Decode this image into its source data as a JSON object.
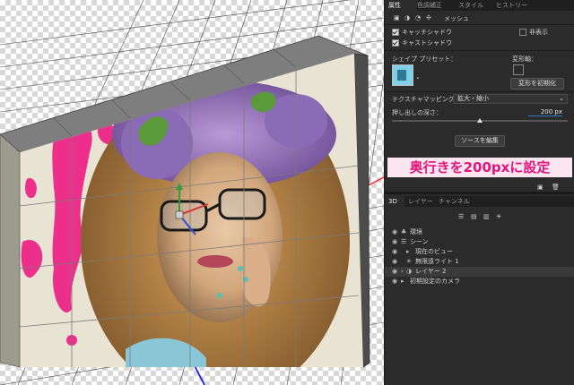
{
  "properties_panel": {
    "tabs": [
      "属性",
      "色調補正",
      "スタイル",
      "ヒストリー"
    ],
    "active_tab": "属性",
    "mode_label": "メッシュ",
    "catch_shadow": "キャッチシャドウ",
    "cast_shadow": "キャストシャドウ",
    "hide_label": "非表示",
    "shape_preset_label": "シェイプ プリセット：",
    "deform_axis_label": "変形軸：",
    "reset_deform_button": "変形を初期化",
    "texture_mapping_label": "テクスチャマッピング：",
    "texture_mapping_value": "拡大・縮小",
    "extrusion_depth_label": "押し出しの深さ：",
    "extrusion_depth_value": "200 px",
    "extrusion_depth_fraction": 0.5,
    "edit_source_button": "ソースを編集",
    "callout": "奥行きを200pxに設定"
  },
  "panel_3d": {
    "tabs": [
      "3D",
      "レイヤー",
      "チャンネル"
    ],
    "active_tab": "3D",
    "layers": [
      {
        "name": "環境",
        "visible": true,
        "indent": 0,
        "selected": false
      },
      {
        "name": "シーン",
        "visible": true,
        "indent": 0,
        "selected": false
      },
      {
        "name": "現在のビュー",
        "visible": true,
        "indent": 1,
        "selected": false
      },
      {
        "name": "無限遠ライト 1",
        "visible": true,
        "indent": 1,
        "selected": false
      },
      {
        "name": "レイヤー 2",
        "visible": true,
        "indent": 1,
        "selected": true
      },
      {
        "name": "初期設定のカメラ",
        "visible": true,
        "indent": 0,
        "selected": false
      }
    ]
  },
  "colors": {
    "panel_bg": "#2b2b2b",
    "callout_text": "#e2157a",
    "callout_bg": "#fbe6f0",
    "grid_line": "#444444",
    "axis_red": "#ff0000",
    "axis_blue": "#0000ff"
  }
}
